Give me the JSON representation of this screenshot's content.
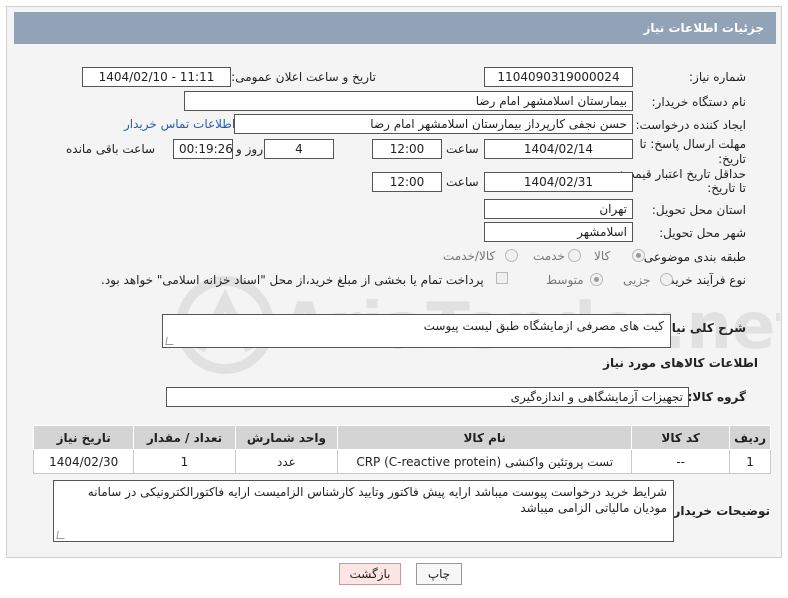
{
  "header": {
    "title": "جزئیات اطلاعات نیاز"
  },
  "form": {
    "need_number_label": "شماره نیاز:",
    "need_number": "1104090319000024",
    "announce_label": "تاریخ و ساعت اعلان عمومی:",
    "announce_value": "1404/02/10 - 11:11",
    "buyer_org_label": "نام دستگاه خریدار:",
    "buyer_org": "بیمارستان اسلامشهر   امام رضا",
    "creator_label": "ایجاد کننده درخواست:",
    "creator": "حسن نجفی کارپرداز بیمارستان اسلامشهر   امام رضا",
    "contact_link": "اطلاعات تماس خریدار",
    "deadline_label_1": "مهلت ارسال پاسخ: تا",
    "deadline_label_2": "تاریخ:",
    "deadline_date": "1404/02/14",
    "time_label": "ساعت",
    "deadline_time": "12:00",
    "days_value": "4",
    "days_label": "روز و",
    "remaining_time": "00:19:26",
    "remaining_label": "ساعت باقی مانده",
    "validity_label_1": "حداقل تاریخ اعتبار قیمت:",
    "validity_label_2": "تا تاریخ:",
    "validity_date": "1404/02/31",
    "validity_time": "12:00",
    "province_label": "استان محل تحویل:",
    "province": "تهران",
    "city_label": "شهر محل تحویل:",
    "city": "اسلامشهر",
    "category_label": "طبقه بندی موضوعی:",
    "category_options": [
      "کالا",
      "خدمت",
      "کالا/خدمت"
    ],
    "category_selected": "کالا",
    "process_label": "نوع فرآیند خرید :",
    "process_options": [
      "جزیی",
      "متوسط"
    ],
    "process_selected": "متوسط",
    "payment_note": "پرداخت تمام یا بخشی از مبلغ خرید،از محل \"اسناد خزانه اسلامی\" خواهد بود."
  },
  "description": {
    "label": "شرح کلی نیاز:",
    "value": "کیت های مصرفی ازمایشگاه طبق لیست پیوست"
  },
  "goods": {
    "section_title": "اطلاعات کالاهای مورد نیاز",
    "group_label": "گروه کالا:",
    "group_value": "تجهیزات آزمایشگاهی و اندازه‌گیری",
    "columns": [
      "ردیف",
      "کد کالا",
      "نام کالا",
      "واحد شمارش",
      "تعداد / مقدار",
      "تاریخ نیاز"
    ],
    "rows": [
      [
        "1",
        "--",
        "تست پروتئین واکنشی (CRP (C-reactive protein",
        "عدد",
        "1",
        "1404/02/30"
      ]
    ]
  },
  "buyer_notes": {
    "label": "توضیحات خریدار:",
    "value": "شرایط خرید درخواست پیوست میباشد ارایه پیش فاکتور وتایید کارشناس الزامیست ارایه فاکتورالکترونیکی در سامانه مودیان مالیاتی الزامی میباشد"
  },
  "buttons": {
    "print": "چاپ",
    "back": "بازگشت"
  },
  "watermark_text": "AriaTender.net"
}
